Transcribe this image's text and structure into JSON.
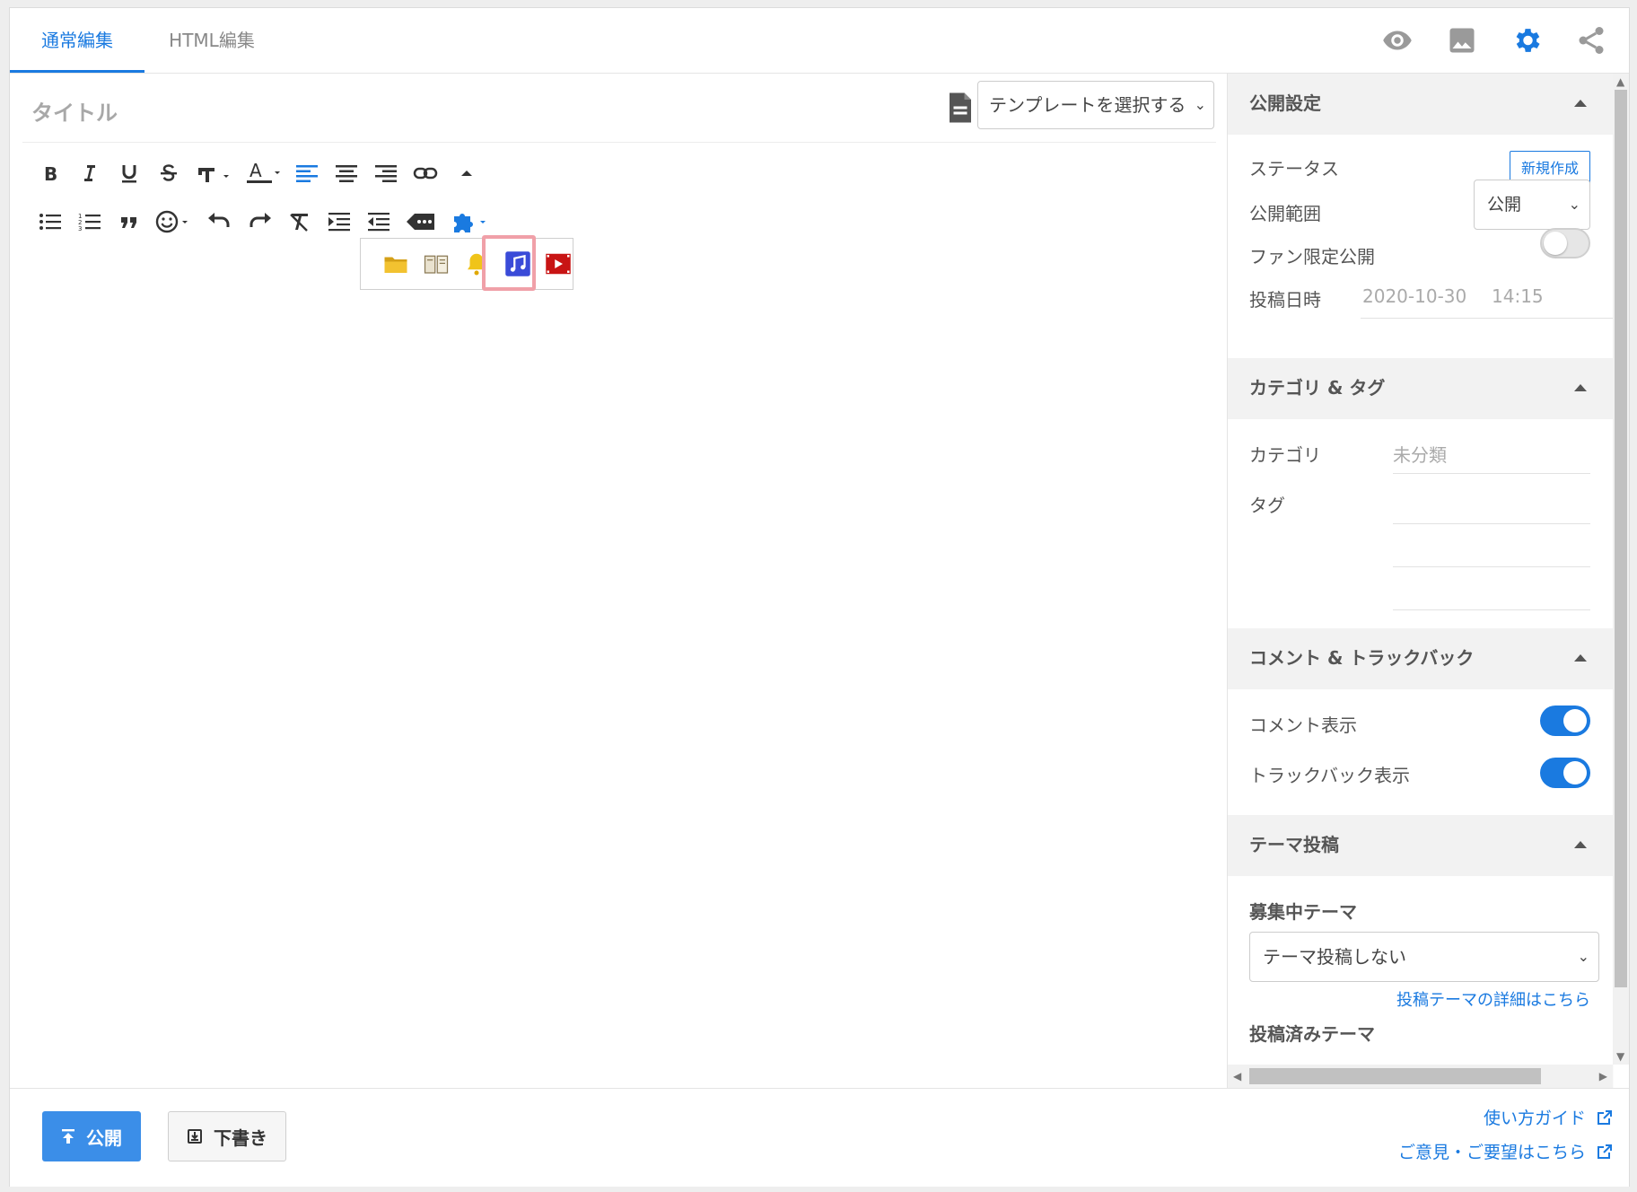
{
  "tabs": {
    "normal": "通常編集",
    "html": "HTML編集"
  },
  "header_icons": [
    "eye-icon",
    "image-icon",
    "gear-icon",
    "share-icon"
  ],
  "editor": {
    "title_placeholder": "タイトル",
    "template_select": "テンプレートを選択する"
  },
  "toolbar_row1": [
    "bold",
    "italic",
    "underline",
    "strikethrough",
    "font-size",
    "text-color",
    "align-left",
    "align-center",
    "align-right",
    "link",
    "collapse"
  ],
  "toolbar_row2": [
    "bullet-list",
    "numbered-list",
    "quote",
    "emoji",
    "undo",
    "redo",
    "clear-format",
    "indent",
    "outdent",
    "more",
    "plugins"
  ],
  "plugin_popup": [
    "folder-icon",
    "book-icon",
    "bell-icon",
    "music-icon",
    "video-icon"
  ],
  "colors": {
    "accent": "#1a7ae0",
    "highlight": "#f0a0a8"
  },
  "sidebar": {
    "publish": {
      "heading": "公開設定",
      "status_label": "ステータス",
      "new_button": "新規作成",
      "scope_label": "公開範囲",
      "scope_value": "公開",
      "fan_label": "ファン限定公開",
      "fan_enabled": false,
      "date_label": "投稿日時",
      "date_value": "2020-10-30",
      "time_value": "14:15"
    },
    "category": {
      "heading": "カテゴリ & タグ",
      "category_label": "カテゴリ",
      "category_value": "未分類",
      "tag_label": "タグ"
    },
    "comments": {
      "heading": "コメント & トラックバック",
      "comment_label": "コメント表示",
      "comment_enabled": true,
      "trackback_label": "トラックバック表示",
      "trackback_enabled": true
    },
    "theme": {
      "heading": "テーマ投稿",
      "recruiting_label": "募集中テーマ",
      "theme_select": "テーマ投稿しない",
      "detail_link": "投稿テーマの詳細はこちら",
      "posted_label": "投稿済みテーマ"
    }
  },
  "footer": {
    "publish_button": "公開",
    "draft_button": "下書き",
    "guide_link": "使い方ガイド",
    "feedback_link": "ご意見・ご要望はこちら"
  }
}
